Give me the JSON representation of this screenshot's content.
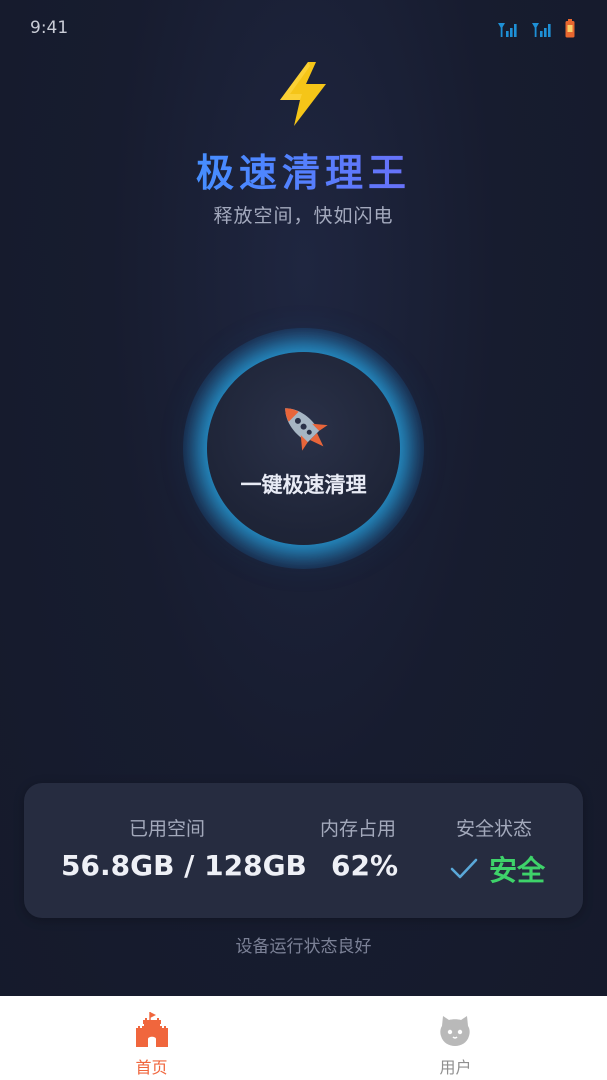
{
  "status_bar": {
    "time": "9:41"
  },
  "header": {
    "title": "极速清理王",
    "subtitle": "释放空间，快如闪电"
  },
  "clean_button": {
    "label": "一键极速清理"
  },
  "stats": {
    "used_space": {
      "label": "已用空间",
      "value": "56.8GB / 128GB"
    },
    "memory": {
      "label": "内存占用",
      "value": "62%"
    },
    "security": {
      "label": "安全状态",
      "value": "安全"
    }
  },
  "device_status": "设备运行状态良好",
  "tab_bar": {
    "home": {
      "label": "首页"
    },
    "user": {
      "label": "用户"
    }
  },
  "colors": {
    "accent_orange": "#f0663d",
    "safe_green": "#3ed36a",
    "glow_blue": "#26aae6",
    "signal_blue": "#1e90d6"
  },
  "icons": [
    "signal-icon",
    "battery-icon",
    "lightning-icon",
    "rocket-icon",
    "check-icon",
    "castle-icon",
    "user-avatar-icon"
  ]
}
